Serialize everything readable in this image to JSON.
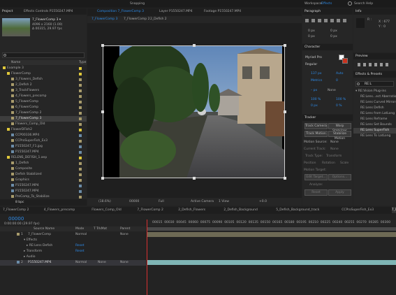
{
  "menubar": {
    "snapping": "Snapping",
    "workspace_label": "Workspace:",
    "workspace": "Effects",
    "search": "Search Help"
  },
  "project": {
    "tab": "Project",
    "tab2": "Effects Controls P1550247.MP4",
    "comp_name": "7_FlowerComp 3 ▾",
    "comp_info1": "4096 x 2160 (1.00)",
    "comp_info2": "Δ 00315, 29.97 fps",
    "search_icon": "search-icon",
    "col_name": "Name",
    "col_type": "Type",
    "items": [
      {
        "indent": 0,
        "name": "Example 3",
        "color": "#e0c83a"
      },
      {
        "indent": 1,
        "name": "FlowerComp",
        "color": "#e0c83a"
      },
      {
        "indent": 2,
        "name": "3_Flowers_Defish",
        "color": "#a89b6b"
      },
      {
        "indent": 2,
        "name": "2_Defish 2",
        "color": "#a89b6b"
      },
      {
        "indent": 2,
        "name": "3_TrackFlowers",
        "color": "#a89b6b"
      },
      {
        "indent": 2,
        "name": "4_Flowers_precomp",
        "color": "#a89b6b"
      },
      {
        "indent": 2,
        "name": "5_FlowerComp",
        "color": "#a89b6b"
      },
      {
        "indent": 2,
        "name": "6_FlowerComp",
        "color": "#a89b6b"
      },
      {
        "indent": 2,
        "name": "7_FlowerComp 2",
        "color": "#a89b6b"
      },
      {
        "indent": 2,
        "name": "7_FlowerComp 3",
        "color": "#a89b6b",
        "selected": true
      },
      {
        "indent": 2,
        "name": "Flowers_Comp_Old",
        "color": "#a89b6b"
      },
      {
        "indent": 1,
        "name": "FlowerDFish2",
        "color": "#e0c83a"
      },
      {
        "indent": 2,
        "name": "CCP00336.MP4",
        "color": "#6b8ca8"
      },
      {
        "indent": 2,
        "name": "CCProSuperFish_Ex3",
        "color": "#a89b6b"
      },
      {
        "indent": 2,
        "name": "P1550247_F1.jpg",
        "color": "#6b8ca8"
      },
      {
        "indent": 2,
        "name": "P1550247.MP4",
        "color": "#6b8ca8"
      },
      {
        "indent": 1,
        "name": "RELENS_DEFISH_1.aep",
        "color": "#e0c83a"
      },
      {
        "indent": 2,
        "name": "1_Defish",
        "color": "#a89b6b"
      },
      {
        "indent": 2,
        "name": "Composite",
        "color": "#a89b6b"
      },
      {
        "indent": 2,
        "name": "Defish Stabilized",
        "color": "#a89b6b"
      },
      {
        "indent": 2,
        "name": "Graphics",
        "color": "#a89b6b"
      },
      {
        "indent": 2,
        "name": "P1550247.MP4",
        "color": "#6b8ca8"
      },
      {
        "indent": 2,
        "name": "P1550247.MP4",
        "color": "#6b8ca8"
      },
      {
        "indent": 2,
        "name": "PreComp_To_Stabilize",
        "color": "#a89b6b"
      }
    ],
    "bpc": "8 bpc"
  },
  "viewer": {
    "tabs": [
      "Composition 7_FlowerComp 3",
      "Layer P1550247.MP4",
      "Footage P1550247.MP4"
    ],
    "crumbs": [
      "7_FlowerComp 3",
      "7_FlowerComp 2",
      "2_Defish 2"
    ],
    "zoom": "(18.6%)",
    "time": "00000",
    "quality": "Full",
    "camera": "Active Camera",
    "views": "1 View",
    "exposure": "+0.0"
  },
  "right": {
    "paragraph": "Paragraph",
    "info": "Info",
    "r_val": "R :",
    "x_val": "X : 677",
    "y_val": "Y : 0",
    "pv_labels": [
      "0 px",
      "0 px",
      "0 px",
      "0 px",
      "0 px"
    ],
    "character": "Character",
    "font": "Myriad Pro",
    "style": "Regular",
    "size": "137 px",
    "leading": "Auto",
    "kerning": "Metrics",
    "tracking": "0",
    "stroke": "– px",
    "stroke_mode": "None",
    "vscale": "100 %",
    "hscale": "100 %",
    "baseline": "0 px",
    "tsume": "0 %",
    "preview": "Preview",
    "effects_presets": "Effects & Presets",
    "search_value": "RE:L",
    "fx_group": "RE:Vision Plug-ins",
    "fx_items": [
      "RE:Lens...ect Aberratio",
      "RE:Lens Curved Mirrors",
      "RE:Lens Defish",
      "RE:Lens from LatLong",
      "RE:Lens Reframe",
      "RE:Lens Set Bounds",
      "RE:Lens SuperFish",
      "RE:Lens To LatLong"
    ],
    "fx_selected": 6,
    "tracker": "Tracker",
    "track_camera": "Track Camera",
    "warp_stabilizer": "Warp Stabilizer",
    "track_motion": "Track Motion",
    "stabilize_motion": "Stabilize Motion",
    "motion_source": "Motion Source:",
    "motion_source_val": "None",
    "current_track": "Current Track:",
    "current_track_val": "None",
    "track_type": "Track Type:",
    "track_type_val": "Transform",
    "position": "Position",
    "rotation": "Rotation",
    "scale": "Scale",
    "motion_target": "Motion Target:",
    "edit_target": "Edit Target...",
    "options": "Options...",
    "analyze": "Analyze:",
    "reset": "Reset",
    "apply": "Apply"
  },
  "timeline": {
    "tabs": [
      "7_FlowerComp 2",
      "4_Flowers_precomp",
      "Flowers_Comp_Old",
      "7_FlowerComp 2",
      "2_Defish_Flowers",
      "2_Defish_Background",
      "5_Defish_Background_track",
      "CCProSuperFish_Ex3",
      "7_FlowerComp 3"
    ],
    "timecode": "00000",
    "tc_sub": "0:00:00:00 (29.97 fps)",
    "col_source": "Source Name",
    "col_mode": "Mode",
    "col_trkmat": "T  TrkMat",
    "col_parent": "Parent",
    "layers": [
      {
        "num": "1",
        "name": "7_FlowerComp",
        "mode": "Normal",
        "parent": "None"
      },
      {
        "num": "2",
        "name": "P1550247.MP4",
        "mode": "Normal",
        "trk": "None",
        "parent": "None"
      }
    ],
    "effects": "Effects",
    "relens": "RE:Lens Defish",
    "reset": "Reset",
    "transform": "Transform",
    "audio": "Audio",
    "ruler": [
      "00015",
      "00030",
      "00045",
      "00060",
      "00075",
      "00090",
      "00105",
      "00120",
      "00135",
      "00150",
      "00165",
      "00180",
      "00195",
      "00210",
      "00225",
      "00240",
      "00255",
      "00270",
      "00285",
      "00300"
    ]
  }
}
